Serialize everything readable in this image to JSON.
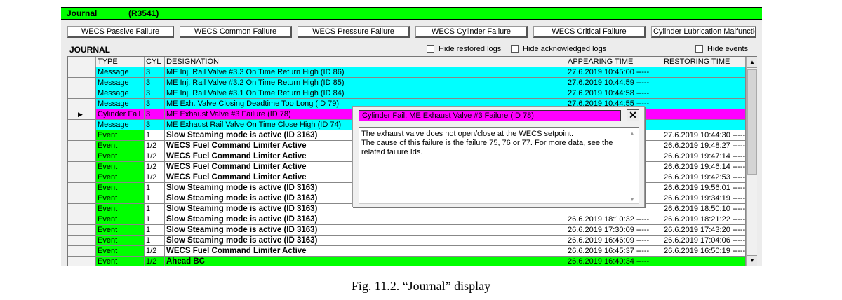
{
  "titlebar": {
    "name": "Journal",
    "code": "(R3541)"
  },
  "filters": [
    "WECS Passive Failure",
    "WECS Common Failure",
    "WECS Pressure Failure",
    "WECS Cylinder Failure",
    "WECS Critical Failure",
    "Cylinder Lubrication Malfunction"
  ],
  "journal": {
    "label": "JOURNAL",
    "hide_restored": "Hide restored logs",
    "hide_acknowledged": "Hide acknowledged logs",
    "hide_events": "Hide events"
  },
  "columns": [
    "TYPE",
    "CYL",
    "DESIGNATION",
    "APPEARING TIME",
    "RESTORING TIME"
  ],
  "colors": {
    "message": "#00ffff",
    "cylinder_fail": "#ff00ff",
    "event": "#00ff00",
    "title_green": "#00ff00"
  },
  "rows": [
    {
      "type": "Message",
      "cyl": "3",
      "designation": "ME Inj. Rail Valve #3.3 On Time Return High (ID 86)",
      "appearing": "27.6.2019  10:45:00 -----",
      "restoring": "",
      "kind": "message",
      "bold": false,
      "selected": false
    },
    {
      "type": "Message",
      "cyl": "3",
      "designation": "ME Inj. Rail Valve #3.2 On Time Return High (ID 85)",
      "appearing": "27.6.2019  10:44:59 -----",
      "restoring": "",
      "kind": "message",
      "bold": false,
      "selected": false
    },
    {
      "type": "Message",
      "cyl": "3",
      "designation": "ME Inj. Rail Valve #3.1 On Time Return High (ID 84)",
      "appearing": "27.6.2019  10:44:58 -----",
      "restoring": "",
      "kind": "message",
      "bold": false,
      "selected": false
    },
    {
      "type": "Message",
      "cyl": "3",
      "designation": "ME Exh. Valve Closing Deadtime Too Long (ID 79)",
      "appearing": "27.6.2019  10:44:55 -----",
      "restoring": "",
      "kind": "message",
      "bold": false,
      "selected": false
    },
    {
      "type": "Cylinder Fail",
      "cyl": "3",
      "designation": "ME Exhaust Valve #3 Failure (ID 78)",
      "appearing": "",
      "restoring": "",
      "kind": "cylinder_fail",
      "bold": false,
      "selected": true
    },
    {
      "type": "Message",
      "cyl": "3",
      "designation": "ME Exhaust Rail Valve On Time Close High (ID 74)",
      "appearing": "",
      "restoring": "",
      "kind": "message",
      "bold": false,
      "selected": false
    },
    {
      "type": "Event",
      "cyl": "1",
      "designation": "Slow Steaming mode is active (ID 3163)",
      "appearing": "",
      "restoring": "27.6.2019  10:44:30 -----",
      "kind": "event",
      "bold": true,
      "selected": false
    },
    {
      "type": "Event",
      "cyl": "1/2",
      "designation": "WECS Fuel Command Limiter Active",
      "appearing": "",
      "restoring": "26.6.2019  19:48:27 -----",
      "kind": "event",
      "bold": true,
      "selected": false
    },
    {
      "type": "Event",
      "cyl": "1/2",
      "designation": "WECS Fuel Command Limiter Active",
      "appearing": "",
      "restoring": "26.6.2019  19:47:14 -----",
      "kind": "event",
      "bold": true,
      "selected": false
    },
    {
      "type": "Event",
      "cyl": "1/2",
      "designation": "WECS Fuel Command Limiter Active",
      "appearing": "",
      "restoring": "26.6.2019  19:46:14 -----",
      "kind": "event",
      "bold": true,
      "selected": false
    },
    {
      "type": "Event",
      "cyl": "1/2",
      "designation": "WECS Fuel Command Limiter Active",
      "appearing": "",
      "restoring": "26.6.2019  19:42:53 -----",
      "kind": "event",
      "bold": true,
      "selected": false
    },
    {
      "type": "Event",
      "cyl": "1",
      "designation": "Slow Steaming mode is active (ID 3163)",
      "appearing": "",
      "restoring": "26.6.2019  19:56:01 -----",
      "kind": "event",
      "bold": true,
      "selected": false
    },
    {
      "type": "Event",
      "cyl": "1",
      "designation": "Slow Steaming mode is active (ID 3163)",
      "appearing": "",
      "restoring": "26.6.2019  19:34:19 -----",
      "kind": "event",
      "bold": true,
      "selected": false
    },
    {
      "type": "Event",
      "cyl": "1",
      "designation": "Slow Steaming mode is active (ID 3163)",
      "appearing": "",
      "restoring": "26.6.2019  18:50:10 -----",
      "kind": "event",
      "bold": true,
      "selected": false
    },
    {
      "type": "Event",
      "cyl": "1",
      "designation": "Slow Steaming mode is active (ID 3163)",
      "appearing": "26.6.2019  18:10:32 -----",
      "restoring": "26.6.2019  18:21:22 -----",
      "kind": "event",
      "bold": true,
      "selected": false
    },
    {
      "type": "Event",
      "cyl": "1",
      "designation": "Slow Steaming mode is active (ID 3163)",
      "appearing": "26.6.2019  17:30:09 -----",
      "restoring": "26.6.2019  17:43:20 -----",
      "kind": "event",
      "bold": true,
      "selected": false
    },
    {
      "type": "Event",
      "cyl": "1",
      "designation": "Slow Steaming mode is active (ID 3163)",
      "appearing": "26.6.2019  16:46:09 -----",
      "restoring": "26.6.2019  17:04:06 -----",
      "kind": "event",
      "bold": true,
      "selected": false
    },
    {
      "type": "Event",
      "cyl": "1/2",
      "designation": "WECS Fuel Command Limiter Active",
      "appearing": "26.6.2019  16:45:37 -----",
      "restoring": "26.6.2019  16:50:19 -----",
      "kind": "event",
      "bold": true,
      "selected": false
    },
    {
      "type": "Event",
      "cyl": "1/2",
      "designation": "Ahead BC",
      "appearing": "26.6.2019  16:40:34 -----",
      "restoring": "",
      "kind": "event_green",
      "bold": true,
      "selected": false
    }
  ],
  "popup": {
    "title": "Cylinder Fail:  ME Exhaust Valve #3 Failure (ID 78)",
    "close": "✕",
    "body": "The exhaust valve does not open/close at the WECS setpoint.\nThe cause of this failure is the failure 75, 76 or 77. For more data, see the related failure Ids."
  },
  "caption": "Fig. 11.2. “Journal” display"
}
